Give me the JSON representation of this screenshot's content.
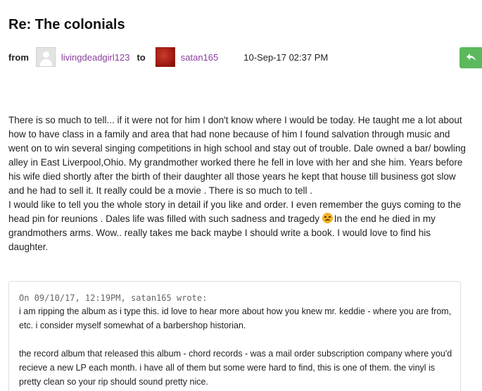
{
  "message": {
    "title": "Re: The colonials",
    "from_label": "from",
    "to_label": "to",
    "sender": {
      "name": "livingdeadgirl123",
      "avatar": "default-avatar-icon"
    },
    "recipient": {
      "name": "satan165",
      "avatar": "red-avatar"
    },
    "date": "10-Sep-17 02:37 PM",
    "reply_button": {
      "icon": "reply-icon",
      "color": "#5cb85c"
    }
  },
  "body": {
    "paragraph_1": "There is so much to tell... if it were not for him I don't know where I would be today. He taught me a lot about how to have class in a family and area that had none because of him I found salvation through music and went on to win several singing competitions in high school and stay out of trouble. Dale owned a bar/ bowling alley in East Liverpool,Ohio. My grandmother worked there he fell in love with her and she him. Years before his wife died shortly after the birth of their daughter all those years he kept that house till business got slow and he had to sell it. It really could be a movie . There is so much to tell .",
    "paragraph_2_before_emoji": "I would like to tell you the whole story in detail if you like and order. I even remember the guys coming to the head pin for reunions . Dales life was filled with such sadness and tragedy",
    "emoji": "sad-face-emoji",
    "paragraph_2_after_emoji": "In the end he died in my grandmothers arms. Wow.. really takes me back maybe I should write a book. I would love to find his daughter."
  },
  "quote": {
    "header": "On 09/10/17, 12:19PM, satan165 wrote:",
    "paragraph_1": "i am ripping the album as i type this. id love to hear more about how you knew mr. keddie - where you are from, etc. i consider myself somewhat of a barbershop historian.",
    "paragraph_2": "the record album that released this album - chord records - was a mail order subscription company where you'd recieve a new LP each month. i have all of them but some were hard to find, this is one of them. the vinyl is pretty clean so your rip should sound pretty nice."
  }
}
